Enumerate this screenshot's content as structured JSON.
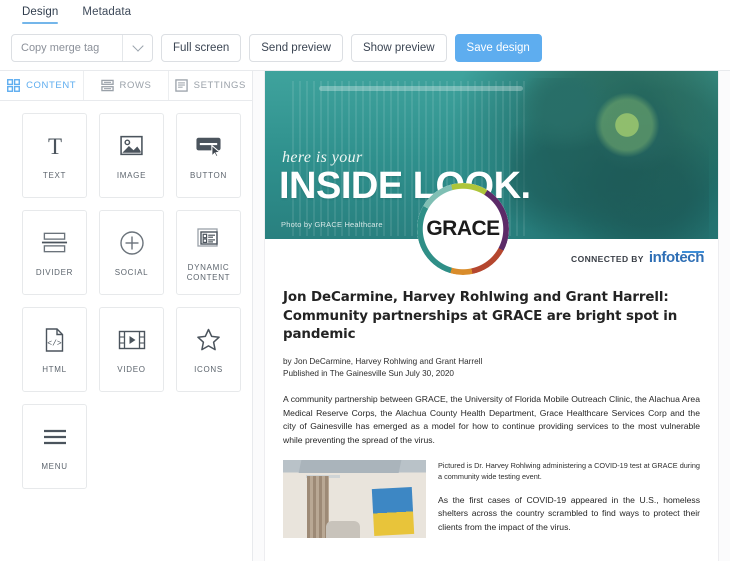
{
  "top_tabs": [
    {
      "label": "Design",
      "active": true
    },
    {
      "label": "Metadata",
      "active": false
    }
  ],
  "toolbar": {
    "merge_tag_value": "Copy merge tag",
    "full_screen_label": "Full screen",
    "send_preview_label": "Send preview",
    "show_preview_label": "Show preview",
    "save_design_label": "Save design",
    "primary_color": "#5eadef"
  },
  "panel": {
    "tabs": [
      {
        "label": "CONTENT",
        "icon": "grid-icon",
        "active": true
      },
      {
        "label": "ROWS",
        "icon": "rows-icon",
        "active": false
      },
      {
        "label": "SETTINGS",
        "icon": "settings-panel-icon",
        "active": false
      }
    ],
    "active_color": "#5eadef",
    "tiles": [
      {
        "label": "TEXT",
        "icon": "text-icon"
      },
      {
        "label": "IMAGE",
        "icon": "image-icon"
      },
      {
        "label": "BUTTON",
        "icon": "button-icon"
      },
      {
        "label": "DIVIDER",
        "icon": "divider-icon"
      },
      {
        "label": "SOCIAL",
        "icon": "social-plus-icon"
      },
      {
        "label": "DYNAMIC CONTENT",
        "icon": "dynamic-content-icon"
      },
      {
        "label": "HTML",
        "icon": "html-code-icon"
      },
      {
        "label": "VIDEO",
        "icon": "video-icon"
      },
      {
        "label": "ICONS",
        "icon": "star-icon"
      },
      {
        "label": "MENU",
        "icon": "menu-hamburger-icon"
      }
    ]
  },
  "preview": {
    "banner": {
      "script_text": "here is your",
      "title": "INSIDE LOOK.",
      "credit": "Photo by GRACE Healthcare",
      "teal": "#2e8f8c"
    },
    "logo": {
      "text": "GRACE",
      "connected_label": "CONNECTED BY",
      "brand": "infotech",
      "brand_color": "#2f6fb5"
    },
    "article": {
      "headline": "Jon DeCarmine, Harvey Rohlwing and Grant Harrell: Community partnerships at GRACE are bright spot in pandemic",
      "byline_author": "by Jon DeCarmine, Harvey Rohlwing and Grant Harrell",
      "byline_published": "Published in The Gainesville Sun July 30, 2020",
      "paragraph_1": "A community partnership between GRACE, the University of Florida Mobile Outreach Clinic, the Alachua Area Medical Reserve Corps, the Alachua County Health Department, Grace Healthcare Services Corp and the city of Gainesville has emerged as a model for how to continue providing services to the most vulnerable while preventing the spread of the virus.",
      "caption": "Pictured is Dr. Harvey Rohlwing administering a COVID-19 test at GRACE during a community wide testing event.",
      "paragraph_2": "As the first cases of COVID-19 appeared in the U.S., homeless shelters across the country scrambled to find ways to protect their clients from the impact of the virus."
    }
  }
}
